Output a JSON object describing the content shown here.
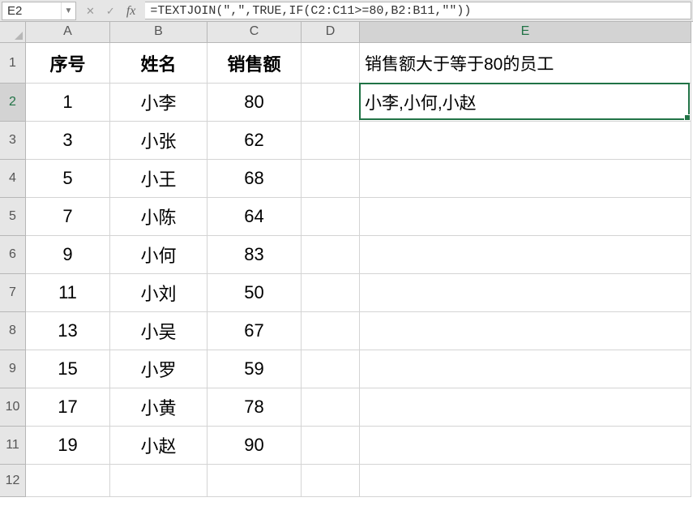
{
  "namebox": "E2",
  "formula": "=TEXTJOIN(\",\",TRUE,IF(C2:C11>=80,B2:B11,\"\"))",
  "columns": [
    "A",
    "B",
    "C",
    "D",
    "E"
  ],
  "colWidths": {
    "A": 104,
    "B": 120,
    "C": 116,
    "D": 72,
    "E": 409
  },
  "rowCount": 12,
  "headRowHeight": 50,
  "dataRowHeight": 47,
  "tailRowHeight": 40,
  "activeCell": {
    "col": "E",
    "row": 2
  },
  "headers": {
    "A": "序号",
    "B": "姓名",
    "C": "销售额",
    "E": "销售额大于等于80的员工"
  },
  "resultCell": {
    "row": 2,
    "col": "E",
    "value": "小李,小何,小赵"
  },
  "data": [
    {
      "A": "1",
      "B": "小李",
      "C": "80"
    },
    {
      "A": "3",
      "B": "小张",
      "C": "62"
    },
    {
      "A": "5",
      "B": "小王",
      "C": "68"
    },
    {
      "A": "7",
      "B": "小陈",
      "C": "64"
    },
    {
      "A": "9",
      "B": "小何",
      "C": "83"
    },
    {
      "A": "11",
      "B": "小刘",
      "C": "50"
    },
    {
      "A": "13",
      "B": "小吴",
      "C": "67"
    },
    {
      "A": "15",
      "B": "小罗",
      "C": "59"
    },
    {
      "A": "17",
      "B": "小黄",
      "C": "78"
    },
    {
      "A": "19",
      "B": "小赵",
      "C": "90"
    }
  ]
}
